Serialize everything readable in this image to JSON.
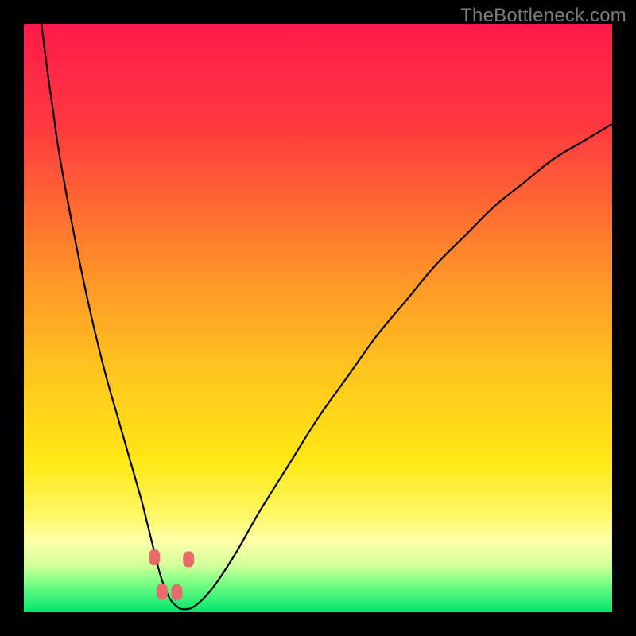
{
  "watermark": "TheBottleneck.com",
  "chart_data": {
    "type": "line",
    "title": "",
    "xlabel": "",
    "ylabel": "",
    "xlim": [
      0,
      100
    ],
    "ylim": [
      0,
      100
    ],
    "grid": false,
    "legend": false,
    "series": [
      {
        "name": "bottleneck-curve",
        "x": [
          3,
          4,
          5,
          6,
          8,
          10,
          12,
          14,
          16,
          18,
          20,
          21,
          22,
          23,
          24,
          25,
          26,
          27,
          29,
          32,
          36,
          40,
          45,
          50,
          55,
          60,
          65,
          70,
          75,
          80,
          85,
          90,
          95,
          100
        ],
        "y": [
          100,
          92,
          85,
          78,
          67,
          57,
          48,
          40,
          33,
          26,
          19,
          15,
          11,
          7,
          4,
          2,
          1,
          0.5,
          1,
          4,
          10,
          17,
          25,
          33,
          40,
          47,
          53,
          59,
          64,
          69,
          73,
          77,
          80,
          83
        ]
      }
    ],
    "markers": [
      {
        "x": 22.2,
        "y": 9.3
      },
      {
        "x": 23.5,
        "y": 3.5
      },
      {
        "x": 26.0,
        "y": 3.4
      },
      {
        "x": 28.0,
        "y": 9.0
      }
    ],
    "gradient_stops": [
      {
        "pct": 0,
        "color": "#ff1a4b"
      },
      {
        "pct": 18,
        "color": "#ff3a3f"
      },
      {
        "pct": 40,
        "color": "#ff8a2a"
      },
      {
        "pct": 58,
        "color": "#ffc21f"
      },
      {
        "pct": 74,
        "color": "#ffe714"
      },
      {
        "pct": 83,
        "color": "#fff760"
      },
      {
        "pct": 88,
        "color": "#fdffa8"
      },
      {
        "pct": 92,
        "color": "#d4ff9a"
      },
      {
        "pct": 95,
        "color": "#7bff85"
      },
      {
        "pct": 100,
        "color": "#00e66b"
      }
    ]
  }
}
